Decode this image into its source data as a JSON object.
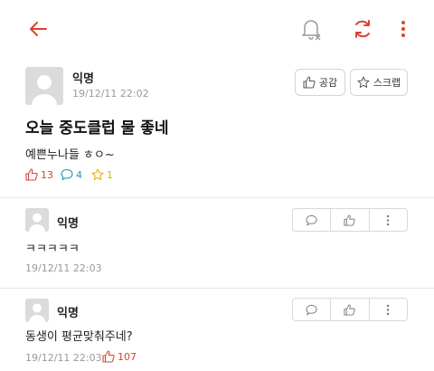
{
  "header": {
    "back_icon": "arrow-left-icon",
    "notify_icon": "bell-off-icon",
    "refresh_icon": "refresh-icon",
    "more_icon": "more-vertical-icon",
    "accent_color": "#d9452b"
  },
  "post": {
    "author": "익명",
    "timestamp": "19/12/11 22:02",
    "title": "오늘 중도클럽 물 좋네",
    "body": "예쁜누나들 ㅎㅇ~",
    "like_label": "공감",
    "scrap_label": "스크랩",
    "stats": {
      "likes": "13",
      "comments": "4",
      "scraps": "1"
    },
    "stat_colors": {
      "likes": "#d9452b",
      "comments": "#1a9bc4",
      "scraps": "#e6b400"
    }
  },
  "comments": [
    {
      "author": "익명",
      "text": "ㅋㅋㅋㅋㅋ",
      "timestamp": "19/12/11 22:03",
      "likes": ""
    },
    {
      "author": "익명",
      "text": "동생이 평균맞춰주네?",
      "timestamp": "19/12/11 22:03",
      "likes": "107"
    }
  ]
}
